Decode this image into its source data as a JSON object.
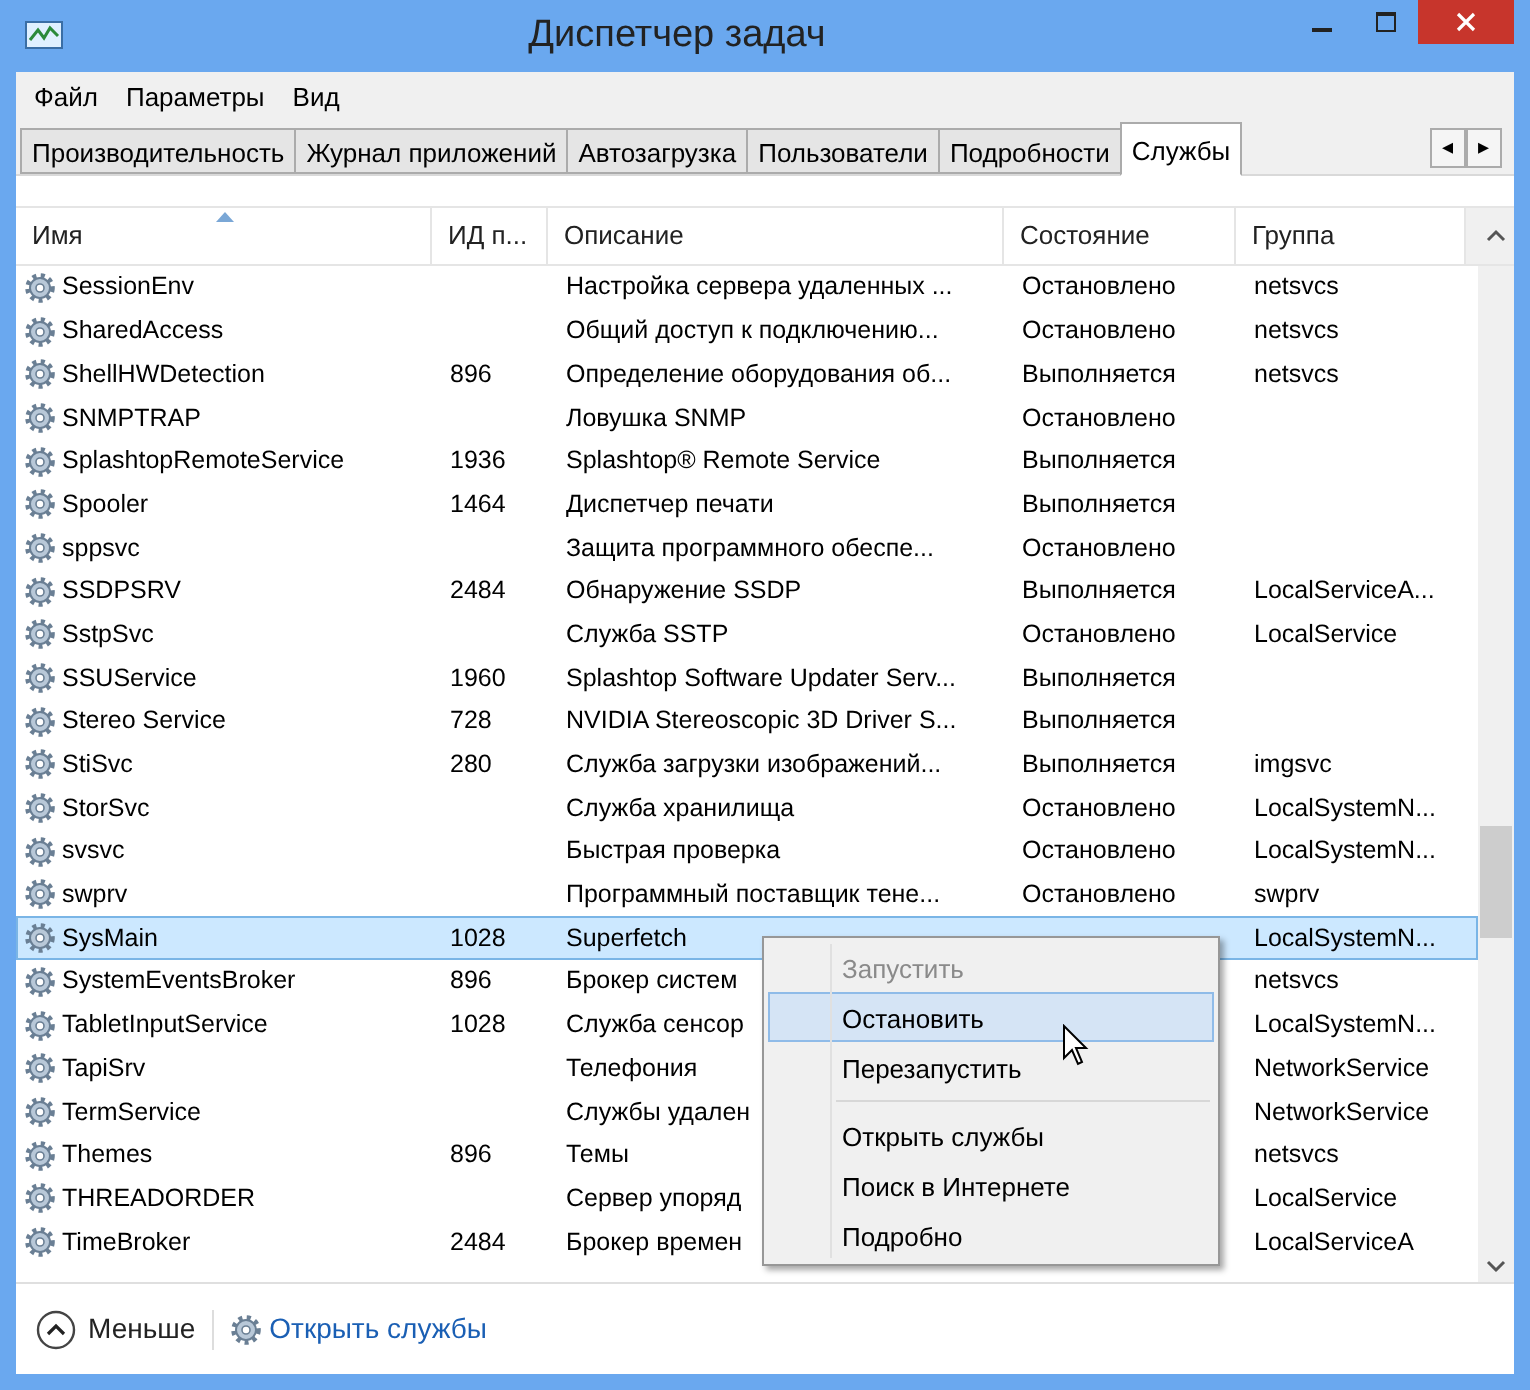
{
  "window": {
    "title": "Диспетчер задач"
  },
  "menu": [
    "Файл",
    "Параметры",
    "Вид"
  ],
  "tabs": [
    {
      "label": "Производительность",
      "selected": false
    },
    {
      "label": "Журнал приложений",
      "selected": false
    },
    {
      "label": "Автозагрузка",
      "selected": false
    },
    {
      "label": "Пользователи",
      "selected": false
    },
    {
      "label": "Подробности",
      "selected": false
    },
    {
      "label": "Службы",
      "selected": true
    }
  ],
  "tab_scroll": [
    "◂",
    "▸"
  ],
  "table": {
    "columns": [
      {
        "label": "Имя",
        "sorted": true
      },
      {
        "label": "ИД п...",
        "sorted": false
      },
      {
        "label": "Описание",
        "sorted": false
      },
      {
        "label": "Состояние",
        "sorted": false
      },
      {
        "label": "Группа",
        "sorted": false
      }
    ],
    "rows": [
      {
        "name": "SessionEnv",
        "description": "Настройка сервера удаленных ...",
        "state": "Остановлено",
        "group": "netsvcs",
        "selected": false
      },
      {
        "name": "SharedAccess",
        "description": "Общий доступ к подключению...",
        "state": "Остановлено",
        "group": "netsvcs",
        "selected": false
      },
      {
        "name": "ShellHWDetection",
        "pid": "896",
        "description": "Определение оборудования об...",
        "state": "Выполняется",
        "group": "netsvcs",
        "selected": false
      },
      {
        "name": "SNMPTRAP",
        "description": "Ловушка SNMP",
        "state": "Остановлено",
        "selected": false
      },
      {
        "name": "SplashtopRemoteService",
        "pid": "1936",
        "description": "Splashtop® Remote Service",
        "state": "Выполняется",
        "selected": false
      },
      {
        "name": "Spooler",
        "pid": "1464",
        "description": "Диспетчер печати",
        "state": "Выполняется",
        "selected": false
      },
      {
        "name": "sppsvc",
        "description": "Защита программного обеспе...",
        "state": "Остановлено",
        "selected": false
      },
      {
        "name": "SSDPSRV",
        "pid": "2484",
        "description": "Обнаружение SSDP",
        "state": "Выполняется",
        "group": "LocalServiceA...",
        "selected": false
      },
      {
        "name": "SstpSvc",
        "description": "Служба SSTP",
        "state": "Остановлено",
        "group": "LocalService",
        "selected": false
      },
      {
        "name": "SSUService",
        "pid": "1960",
        "description": "Splashtop Software Updater Serv...",
        "state": "Выполняется",
        "selected": false
      },
      {
        "name": "Stereo Service",
        "pid": "728",
        "description": "NVIDIA Stereoscopic 3D Driver S...",
        "state": "Выполняется",
        "selected": false
      },
      {
        "name": "StiSvc",
        "pid": "280",
        "description": "Служба загрузки изображений...",
        "state": "Выполняется",
        "group": "imgsvc",
        "selected": false
      },
      {
        "name": "StorSvc",
        "description": "Служба хранилища",
        "state": "Остановлено",
        "group": "LocalSystemN...",
        "selected": false
      },
      {
        "name": "svsvc",
        "description": "Быстрая проверка",
        "state": "Остановлено",
        "group": "LocalSystemN...",
        "selected": false
      },
      {
        "name": "swprv",
        "description": "Программный поставщик тене...",
        "state": "Остановлено",
        "group": "swprv",
        "selected": false
      },
      {
        "name": "SysMain",
        "pid": "1028",
        "description": "Superfetch",
        "group": "LocalSystemN...",
        "selected": true
      },
      {
        "name": "SystemEventsBroker",
        "pid": "896",
        "description": "Брокер систем",
        "group": "netsvcs",
        "selected": false
      },
      {
        "name": "TabletInputService",
        "pid": "1028",
        "description": "Служба сенсор",
        "group": "LocalSystemN...",
        "selected": false
      },
      {
        "name": "TapiSrv",
        "description": "Телефония",
        "group": "NetworkService",
        "selected": false
      },
      {
        "name": "TermService",
        "description": "Службы удален",
        "group": "NetworkService",
        "selected": false
      },
      {
        "name": "Themes",
        "pid": "896",
        "description": "Темы",
        "group": "netsvcs",
        "selected": false
      },
      {
        "name": "THREADORDER",
        "description": "Сервер упоряд",
        "group": "LocalService",
        "selected": false
      },
      {
        "name": "TimeBroker",
        "pid": "2484",
        "description": "Брокер времен",
        "group": "LocalServiceA",
        "selected": false
      }
    ]
  },
  "context_menu": [
    {
      "kind": "item",
      "label": "Запустить",
      "disabled": true,
      "selected": false
    },
    {
      "kind": "item",
      "label": "Остановить",
      "disabled": false,
      "selected": true
    },
    {
      "kind": "item",
      "label": "Перезапустить",
      "disabled": false,
      "selected": false
    },
    {
      "kind": "separator"
    },
    {
      "kind": "item",
      "label": "Открыть службы",
      "disabled": false,
      "selected": false
    },
    {
      "kind": "item",
      "label": "Поиск в Интернете",
      "disabled": false,
      "selected": false
    },
    {
      "kind": "item",
      "label": "Подробно",
      "disabled": false,
      "selected": false
    }
  ],
  "footer": {
    "less": "Меньше",
    "open_services": "Открыть службы"
  }
}
